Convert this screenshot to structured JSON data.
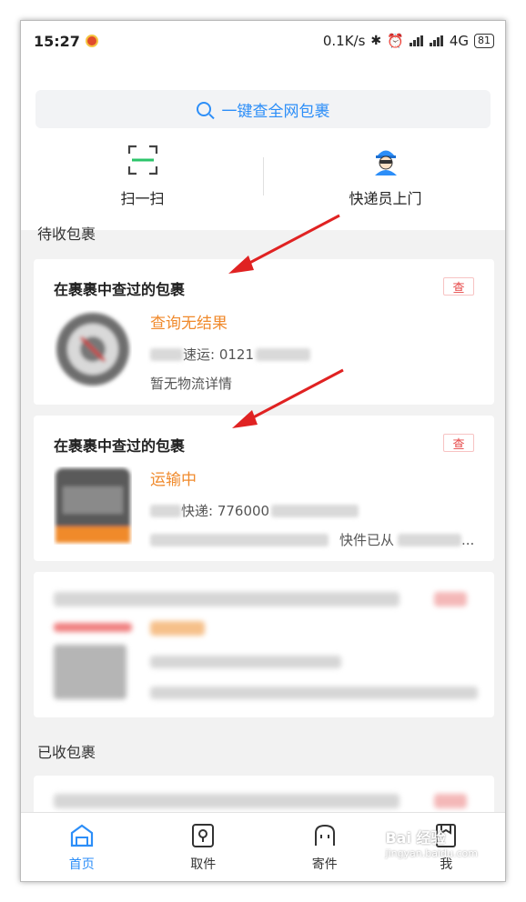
{
  "status_bar": {
    "time": "15:27",
    "speed": "0.1K/s",
    "network": "4G",
    "battery": "81"
  },
  "search": {
    "label": "一键查全网包裹"
  },
  "quick_actions": [
    {
      "label": "扫一扫",
      "icon": "scan-icon"
    },
    {
      "label": "快递员上门",
      "icon": "courier-icon"
    }
  ],
  "sections": {
    "pending": "待收包裹",
    "received": "已收包裹"
  },
  "cards": [
    {
      "title": "在裹裹中查过的包裹",
      "badge": "查",
      "status": "查询无结果",
      "carrier_suffix": "速运: 0121",
      "detail": "暂无物流详情"
    },
    {
      "title": "在裹裹中查过的包裹",
      "badge": "查",
      "status": "运输中",
      "carrier_suffix": "快递: 776000",
      "detail": "快件已从",
      "detail_tail": "..."
    }
  ],
  "tabs": [
    {
      "label": "首页",
      "icon": "home-icon",
      "active": true
    },
    {
      "label": "取件",
      "icon": "pickup-icon",
      "active": false
    },
    {
      "label": "寄件",
      "icon": "send-icon",
      "active": false
    },
    {
      "label": "我",
      "icon": "profile-icon",
      "active": false
    }
  ],
  "watermark": {
    "line1": "Bai 经验",
    "line2": "jingyan.baidu.com"
  },
  "colors": {
    "accent": "#2c8ef8",
    "status_orange": "#f08a2c",
    "badge_red": "#e64545",
    "arrow_red": "#e02222"
  }
}
